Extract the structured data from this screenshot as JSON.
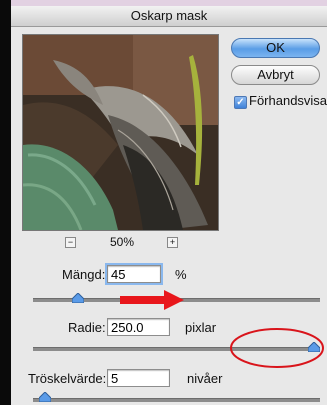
{
  "dialog": {
    "title": "Oskarp mask"
  },
  "buttons": {
    "ok_label": "OK",
    "cancel_label": "Avbryt"
  },
  "preview_option": {
    "label": "Förhandsvisa",
    "checked": true
  },
  "zoom": {
    "level": "50%",
    "minus": "−",
    "plus": "+"
  },
  "amount": {
    "label": "Mängd:",
    "value": "45",
    "unit": "%",
    "slider_fraction": 0.14
  },
  "radius": {
    "label": "Radie:",
    "value": "250.0",
    "unit": "pixlar",
    "slider_fraction": 1.0
  },
  "threshold": {
    "label": "Tröskelvärde:",
    "value": "5",
    "unit": "nivåer",
    "slider_fraction": 0.02
  },
  "annotations": {
    "arrow_color": "#e8161b",
    "circle_color": "#d9141b"
  },
  "colors": {
    "accent": "#3f82d9"
  }
}
